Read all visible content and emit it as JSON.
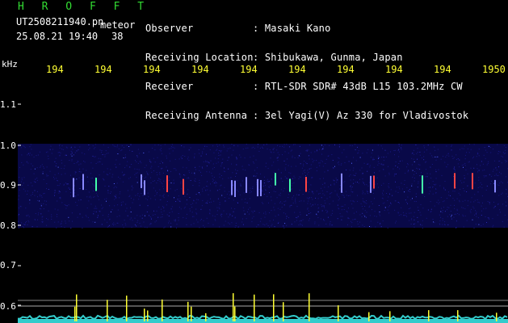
{
  "header": {
    "title": "H R O F F T",
    "filename": "UT2508211940.pn",
    "meteor_tag": "meteor",
    "datetime": "25.08.21 19:40",
    "count": "38",
    "fields": [
      {
        "label": "Observer",
        "value": ": Masaki Kano"
      },
      {
        "label": "Receiving Location",
        "value": ": Shibukawa, Gunma, Japan"
      },
      {
        "label": "Receiver",
        "value": ": RTL-SDR SDR# 43dB L15 103.2MHz CW"
      },
      {
        "label": "Receiving Antenna",
        "value": ": 3el Yagi(V) Az 330 for Vladivostok"
      }
    ]
  },
  "axes": {
    "y_unit": "kHz",
    "y_ticks": [
      "1.1",
      "1.0",
      "0.9",
      "0.8",
      "0.7",
      "0.6"
    ],
    "x_ticks": [
      "194",
      "194",
      "194",
      "194",
      "194",
      "194",
      "194",
      "194",
      "194",
      "1950"
    ]
  },
  "colors": {
    "background": "#000000",
    "text": "#ffffff",
    "title": "#33dd33",
    "time_labels": "#ffff33",
    "noise_band": "#1a1a80",
    "baseline": "#33cccc",
    "spikes": "#ffff33"
  }
}
